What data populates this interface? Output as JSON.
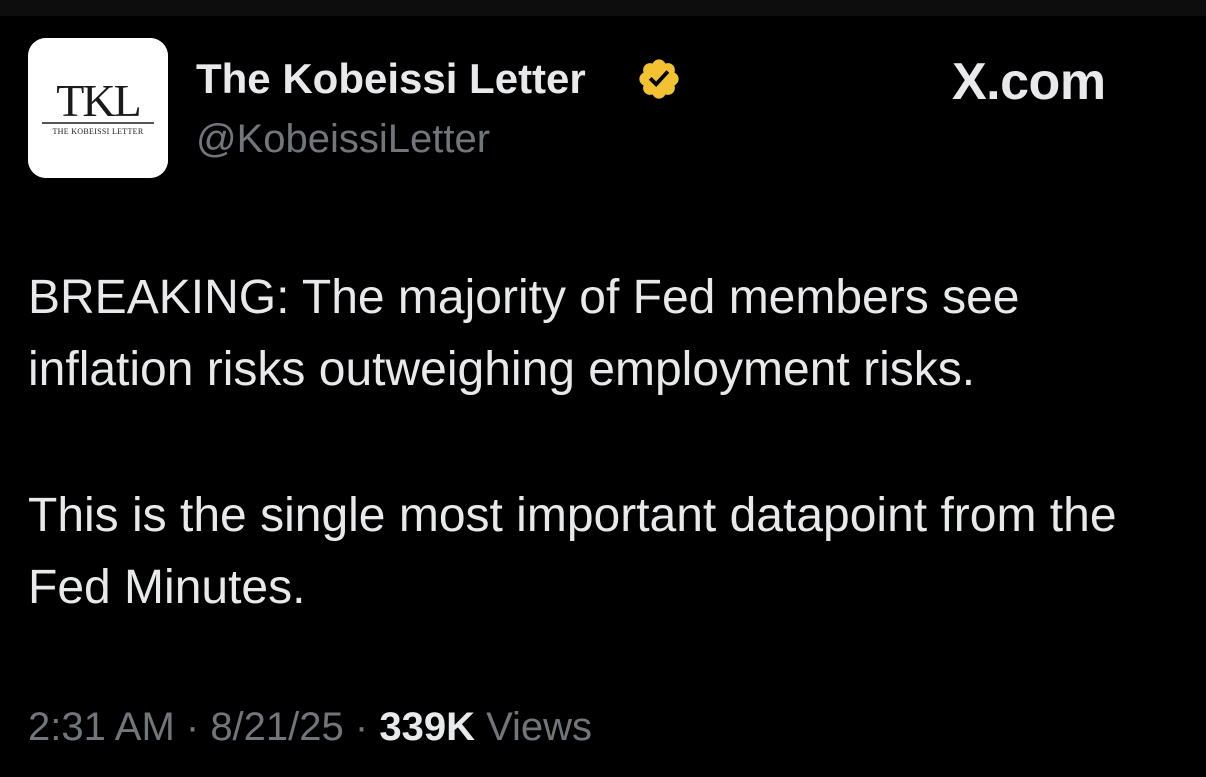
{
  "author": {
    "display_name": "The Kobeissi Letter",
    "handle": "@KobeissiLetter",
    "avatar_logo_text": "TKL",
    "avatar_logo_subtext": "THE KOBEISSI LETTER",
    "verified_badge_icon": "verified-badge-icon",
    "verified_color": "#f2c233"
  },
  "brand": {
    "label": "X.com"
  },
  "tweet": {
    "paragraphs": [
      "BREAKING: The majority of Fed members see inflation risks outweighing employment risks.",
      "This is the single most important datapoint from the Fed Minutes."
    ]
  },
  "meta": {
    "time": "2:31 AM",
    "sep1": " · ",
    "date": "8/21/25",
    "sep2": " · ",
    "views_count": "339K",
    "views_label": " Views"
  }
}
